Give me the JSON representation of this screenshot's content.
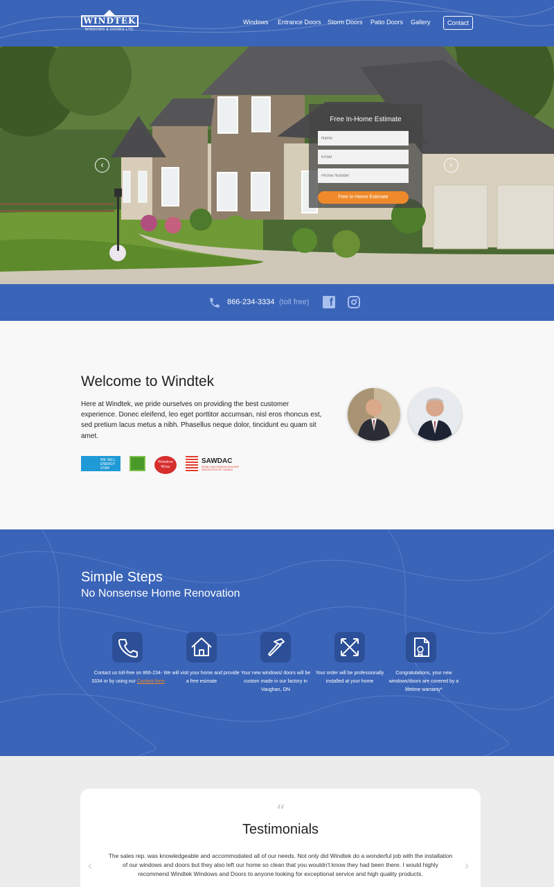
{
  "header": {
    "logo_text": "WINDTEK",
    "logo_sub": "WINDOWS & DOORS LTD.",
    "nav": [
      {
        "label": "Windows"
      },
      {
        "label": "Entrance Doors"
      },
      {
        "label": "Storm Doors"
      },
      {
        "label": "Patio Doors"
      },
      {
        "label": "Gallery"
      }
    ],
    "contact_label": "Contact"
  },
  "hero": {
    "prev_icon": "chevron-left-icon",
    "next_icon": "chevron-right-icon",
    "form": {
      "title": "Free In-Home Estimate",
      "name_placeholder": "Name",
      "email_placeholder": "Email",
      "phone_placeholder": "Phone Number",
      "submit_label": "Free In-Home Estimate"
    }
  },
  "phonebar": {
    "phone": "866-234-3334",
    "toll": "(toll free)",
    "icons": [
      "phone-icon",
      "facebook-icon",
      "instagram-icon"
    ]
  },
  "welcome": {
    "title": "Welcome to Windtek",
    "body": "Here at Windtek, we pride ourselves on providing the best customer experience. Donec eleifend, leo eget porttitor accumsan, nisl eros rhoncus est, sed pretium lacus metus a nibh. Phasellus neque dolor, tincidunt eu quam sit amet.",
    "badges": {
      "energy_star": "WE SELL ENERGY STAR",
      "window_wise": "Window Wise",
      "sawdac": "SAWDAC",
      "sawdac_sub": "SIDING AND WINDOW DEALERS ASSOCIATION OF CANADA"
    }
  },
  "steps": {
    "title": "Simple Steps",
    "subtitle": "No Nonsense Home Renovation",
    "items": [
      {
        "icon": "phone-icon",
        "text_before": "Contact us toll-free on 866-234-3334 or by using our ",
        "link": "Contact form"
      },
      {
        "icon": "house-icon",
        "text": "We will visit your home and provide a free esimate"
      },
      {
        "icon": "hammer-icon",
        "text": "Your new windows/ doors will be custom made in our factory in Vaughan, ON"
      },
      {
        "icon": "expand-arrows-icon",
        "text": "Your order will be professionally installed at your home"
      },
      {
        "icon": "certificate-icon",
        "text": "Congratulations, your new windows/doors are covered by a lifetime warranty*"
      }
    ]
  },
  "testimonials": {
    "quote_mark": "“",
    "title": "Testimonials",
    "text": "The sales rep. was knowledgeable and accommodated all of our needs. Not only did Windtek do a wonderful job with the installation of our windows and doors but they also left our home so clean that you wouldn't know they had been there. I would highly recommend Windtek Windows and Doors to anyone looking for exceptional service and high quality products.",
    "prev": "‹",
    "next": "›"
  },
  "colors": {
    "brand_blue": "#3a64b8",
    "accent_orange": "#ef8a2a"
  }
}
